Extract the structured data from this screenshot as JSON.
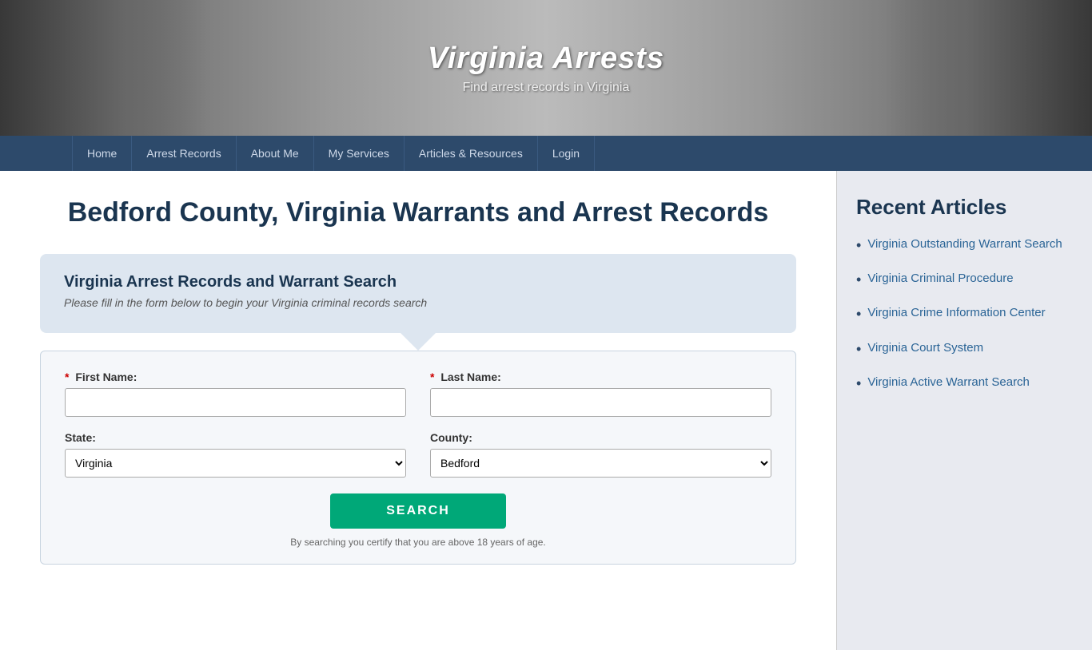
{
  "header": {
    "site_title": "Virginia Arrests",
    "site_subtitle": "Find arrest records in Virginia"
  },
  "nav": {
    "items": [
      {
        "label": "Home",
        "href": "#"
      },
      {
        "label": "Arrest Records",
        "href": "#"
      },
      {
        "label": "About Me",
        "href": "#"
      },
      {
        "label": "My Services",
        "href": "#"
      },
      {
        "label": "Articles & Resources",
        "href": "#"
      },
      {
        "label": "Login",
        "href": "#"
      }
    ]
  },
  "main": {
    "page_title": "Bedford County, Virginia Warrants and Arrest Records",
    "search_box": {
      "title": "Virginia Arrest Records and Warrant Search",
      "subtitle": "Please fill in the form below to begin your Virginia criminal records search"
    },
    "form": {
      "first_name_label": "First Name:",
      "last_name_label": "Last Name:",
      "state_label": "State:",
      "county_label": "County:",
      "state_value": "Virginia",
      "county_value": "Bedford",
      "search_button": "SEARCH",
      "disclaimer": "By searching you certify that you are above 18 years of age."
    }
  },
  "sidebar": {
    "title": "Recent Articles",
    "articles": [
      {
        "label": "Virginia Outstanding Warrant Search",
        "href": "#"
      },
      {
        "label": "Virginia Criminal Procedure",
        "href": "#"
      },
      {
        "label": "Virginia Crime Information Center",
        "href": "#"
      },
      {
        "label": "Virginia Court System",
        "href": "#"
      },
      {
        "label": "Virginia Active Warrant Search",
        "href": "#"
      }
    ]
  }
}
